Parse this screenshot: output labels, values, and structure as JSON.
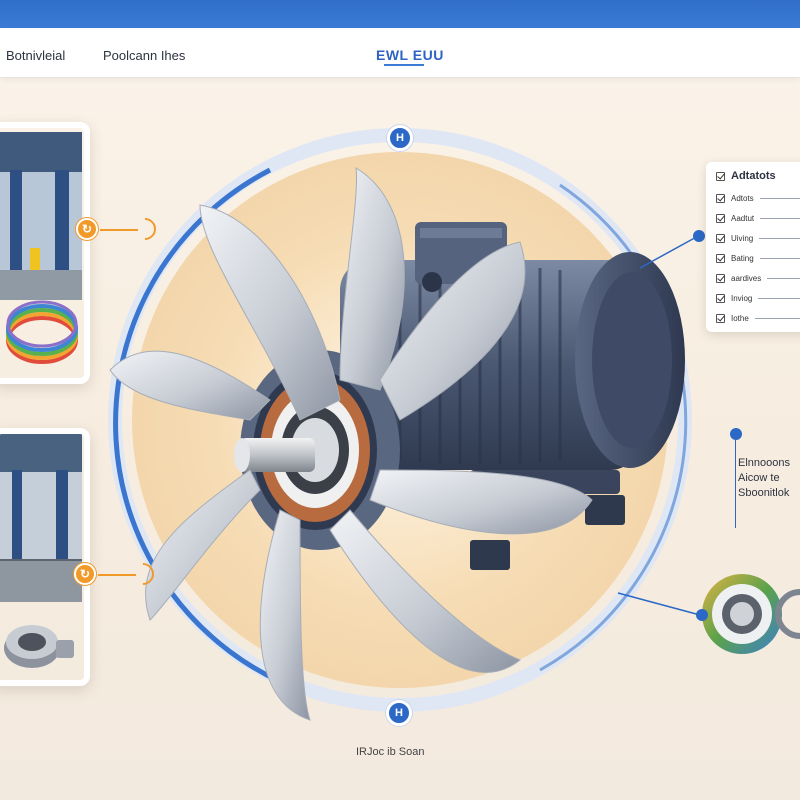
{
  "header": {
    "nav_left_1": "Botnivleial",
    "nav_left_2": "Poolcann Ihes",
    "brand": "EWL EUU"
  },
  "markers": {
    "top_node": "H",
    "bottom_node": "H"
  },
  "checklist": {
    "title": "Adtatots",
    "items": [
      "Adtots",
      "Aadtut",
      "Uiving",
      "Bating",
      "aardives",
      "Inviog",
      "Iothe"
    ]
  },
  "side_note": {
    "lines": [
      "Elnnooons",
      "Aicow te",
      "Sboonitlok"
    ]
  },
  "caption": "IRJoc ib Soan",
  "colors": {
    "accent": "#2c68c6",
    "orange": "#f19a2a",
    "top_band": "#2f6ec9"
  }
}
